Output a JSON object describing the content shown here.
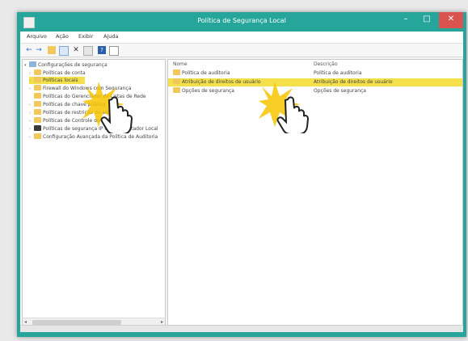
{
  "window": {
    "title": "Política de Segurança Local",
    "controls": {
      "minimize": "–",
      "maximize": "□",
      "close": "✕"
    }
  },
  "menu": {
    "items": [
      "Arquivo",
      "Ação",
      "Exibir",
      "Ajuda"
    ]
  },
  "toolbar": {
    "icons": [
      "back-icon",
      "forward-icon",
      "up-folder-icon",
      "show-hide-tree-icon",
      "delete-icon",
      "export-icon",
      "help-icon",
      "properties-icon"
    ]
  },
  "tree": {
    "items": [
      {
        "label": "Configurações de segurança",
        "level": 0
      },
      {
        "label": "Políticas de conta",
        "level": 1
      },
      {
        "label": "Políticas locais",
        "level": 1,
        "selected": true
      },
      {
        "label": "Firewall do Windows com Segurança",
        "level": 1
      },
      {
        "label": "Políticas do Gerenciador de Listas de Rede",
        "level": 1
      },
      {
        "label": "Políticas de chave pública",
        "level": 1
      },
      {
        "label": "Políticas de restrição de software",
        "level": 1
      },
      {
        "label": "Políticas de Controle de Aplicativo",
        "level": 1
      },
      {
        "label": "Políticas de segurança IP em Computador Local",
        "level": 1
      },
      {
        "label": "Configuração Avançada da Política de Auditoria",
        "level": 1
      }
    ]
  },
  "list": {
    "columns": {
      "name": "Nome",
      "description": "Descrição"
    },
    "rows": [
      {
        "name": "Política de auditoria",
        "description": "Política de auditoria"
      },
      {
        "name": "Atribuição de direitos de usuário",
        "description": "Atribuição de direitos de usuário",
        "highlight": true
      },
      {
        "name": "Opções de segurança",
        "description": "Opções de segurança"
      }
    ]
  },
  "colors": {
    "accent": "#26a69a",
    "highlight": "#f3e04a",
    "close": "#d9534f",
    "folder": "#f2c75c"
  }
}
